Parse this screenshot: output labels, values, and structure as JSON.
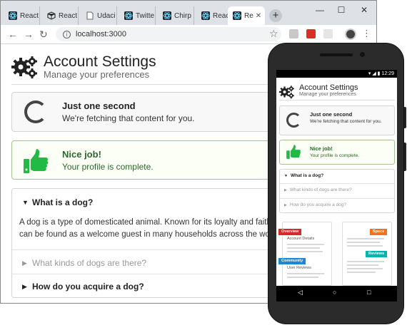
{
  "browser": {
    "tabs": [
      {
        "label": "React",
        "icon": "react-icon"
      },
      {
        "label": "React",
        "icon": "cube-icon"
      },
      {
        "label": "Udaci",
        "icon": "page-icon"
      },
      {
        "label": "Twitte",
        "icon": "react-icon"
      },
      {
        "label": "Chirp",
        "icon": "react-icon"
      },
      {
        "label": "React",
        "icon": "react-icon"
      },
      {
        "label": "Re",
        "icon": "react-icon"
      }
    ],
    "url": "localhost:3000"
  },
  "page": {
    "title": "Account Settings",
    "subtitle": "Manage your preferences",
    "loading": {
      "title": "Just one second",
      "text": "We're fetching that content for you."
    },
    "success": {
      "title": "Nice job!",
      "text": "Your profile is complete."
    },
    "accordion": {
      "items": [
        {
          "title": "What is a dog?",
          "state": "open"
        },
        {
          "title": "What kinds of dogs are there?",
          "state": "collapsed-muted"
        },
        {
          "title": "How do you acquire a dog?",
          "state": "collapsed"
        }
      ],
      "body_line1": "A dog is a type of domesticated animal. Known for its loyalty and faith",
      "body_line2": "can be found as a welcome guest in many households across the worl"
    }
  },
  "phone": {
    "status_time": "12:29",
    "title": "Account Settings",
    "subtitle": "Manage your preferences",
    "loading_title": "Just one second",
    "loading_text": "We're fetching that content for you.",
    "success_title": "Nice job!",
    "success_text": "Your profile is complete.",
    "acc_items": [
      "What is a dog?",
      "What kinds of dogs are there?",
      "How do you acquire a dog?"
    ],
    "illus_labels": {
      "overview": "Overview",
      "account_details": "Account Details",
      "community": "Community",
      "user_reviews": "User Reviews",
      "specs": "Specs",
      "reviews": "Reviews"
    }
  },
  "colors": {
    "success_bg": "#fcfff5",
    "success_text": "#2c662d",
    "success_border": "#a3c293",
    "thumb_green": "#21ba45",
    "ribbon_red": "#db2828",
    "ribbon_blue": "#2185d0",
    "ribbon_orange": "#f2711c",
    "ribbon_teal": "#00b5ad"
  }
}
